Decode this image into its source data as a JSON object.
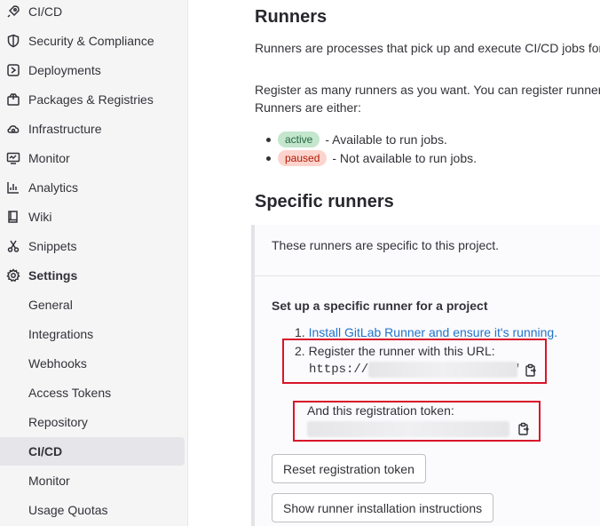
{
  "sidebar": {
    "items": [
      {
        "label": "CI/CD",
        "icon": "rocket-icon"
      },
      {
        "label": "Security & Compliance",
        "icon": "shield-icon"
      },
      {
        "label": "Deployments",
        "icon": "deployments-icon"
      },
      {
        "label": "Packages & Registries",
        "icon": "package-icon"
      },
      {
        "label": "Infrastructure",
        "icon": "cloud-gear-icon"
      },
      {
        "label": "Monitor",
        "icon": "monitor-icon"
      },
      {
        "label": "Analytics",
        "icon": "chart-icon"
      },
      {
        "label": "Wiki",
        "icon": "book-icon"
      },
      {
        "label": "Snippets",
        "icon": "scissors-icon"
      },
      {
        "label": "Settings",
        "icon": "settings-icon"
      }
    ],
    "settings_items": [
      {
        "label": "General"
      },
      {
        "label": "Integrations"
      },
      {
        "label": "Webhooks"
      },
      {
        "label": "Access Tokens"
      },
      {
        "label": "Repository"
      },
      {
        "label": "CI/CD",
        "active": true
      },
      {
        "label": "Monitor"
      },
      {
        "label": "Usage Quotas"
      }
    ]
  },
  "main": {
    "runners_title": "Runners",
    "runners_desc": "Runners are processes that pick up and execute CI/CD jobs for G",
    "register_desc": "Register as many runners as you want. You can register runners",
    "runners_are": "Runners are either:",
    "states": [
      {
        "badge": "active",
        "text": "- Available to run jobs."
      },
      {
        "badge": "paused",
        "text": "- Not available to run jobs."
      }
    ],
    "specific_title": "Specific runners",
    "specific_desc": "These runners are specific to this project.",
    "setup_title": "Set up a specific runner for a project",
    "step1_num": "1.",
    "step1_link": "Install GitLab Runner and ensure it's running.",
    "step2_num": "2.",
    "step2_text": "Register the runner with this URL:",
    "url_prefix": "https://",
    "url_suffix": "'",
    "token_label": "And this registration token:",
    "reset_button": "Reset registration token",
    "instructions_button": "Show runner installation instructions"
  },
  "colors": {
    "highlight_box": "#d9152a",
    "link": "#1f75cb",
    "active_badge_bg": "#c3e6cd",
    "paused_badge_bg": "#fdd4cd"
  }
}
